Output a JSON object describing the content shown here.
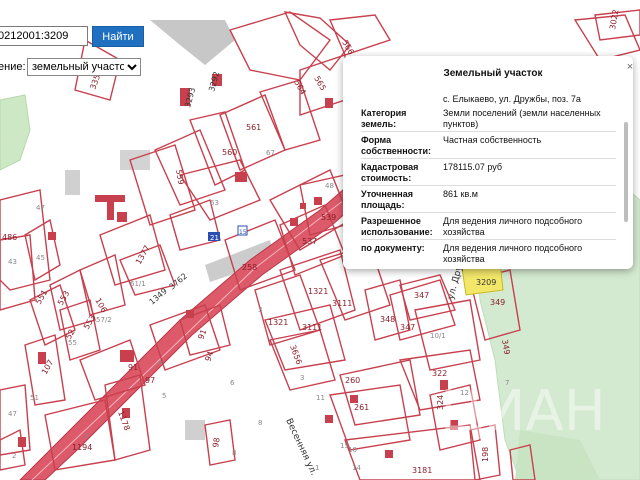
{
  "search": {
    "input_value": "0212001:3209",
    "find_label": "Найти",
    "type_label": "ение:",
    "type_selected": "земельный участок"
  },
  "popup": {
    "title": "Земельный участок",
    "address": "с. Елыкаево, ул. Дружбы, поз. 7а",
    "rows": [
      {
        "label": "Категория земель:",
        "value": "Земли поселений (земли населенных пунктов)"
      },
      {
        "label": "Форма собственности:",
        "value": "Частная собственность"
      },
      {
        "label": "Кадастровая стоимость:",
        "value": "178115.07 руб"
      },
      {
        "label": "Уточненная площадь:",
        "value": "861 кв.м"
      },
      {
        "label": "Разрешенное использование:",
        "value": "Для ведения личного подсобного хозяйства"
      },
      {
        "label": "по документу:",
        "value": "Для ведения личного подсобного хозяйства"
      }
    ],
    "close_icon": "close-icon"
  },
  "map": {
    "parcel_labels": [
      "3351",
      "3293",
      "3292",
      "565",
      "564",
      "566",
      "561",
      "560",
      "559",
      "67",
      "63",
      "48",
      "539",
      "537",
      "258",
      "1321",
      "3111",
      "3656",
      "3111",
      "1321",
      "348",
      "347",
      "347",
      "10/1",
      "322",
      "349",
      "349",
      "3209",
      "3022",
      "486",
      "43",
      "47",
      "1377",
      "61/1",
      "106",
      "551",
      "553",
      "553",
      "57/2",
      "55",
      "52",
      "107",
      "91",
      "97",
      "91",
      "94",
      "260",
      "261",
      "324",
      "198",
      "1178",
      "1194",
      "98",
      "3181",
      "51",
      "47",
      "45"
    ],
    "small_labels": [
      "3",
      "8",
      "6",
      "5",
      "4",
      "2",
      "1",
      "3",
      "10",
      "14",
      "15",
      "7",
      "12",
      "2",
      "11",
      "8"
    ],
    "street_labels": [
      "ул. Дружбы",
      "Весенняя ул.",
      "1349",
      "3762"
    ],
    "markers": [
      "21",
      "15"
    ]
  }
}
